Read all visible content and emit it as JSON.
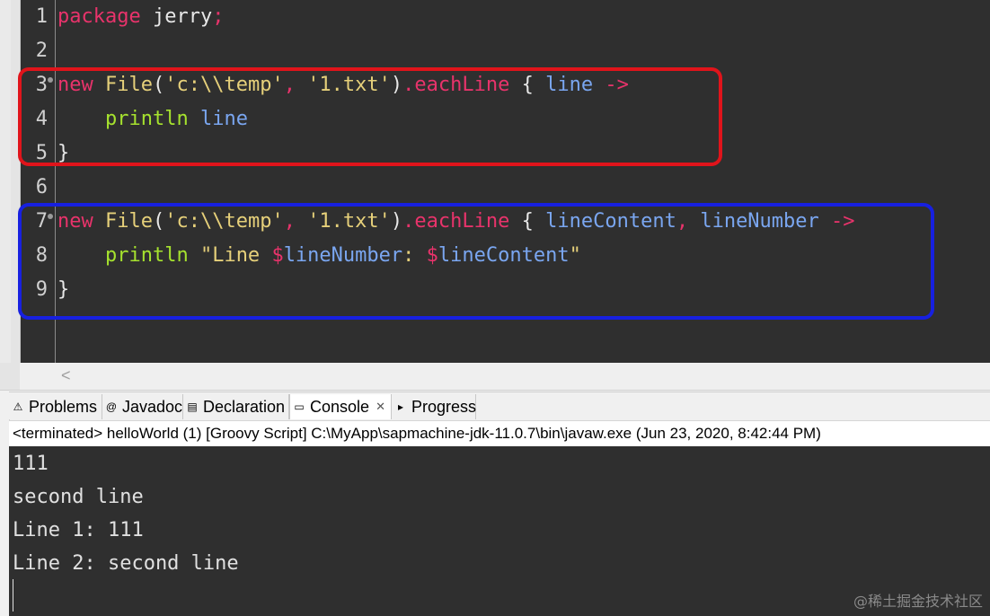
{
  "editor": {
    "lines": [
      {
        "num": "1",
        "tokens": [
          {
            "t": "package",
            "c": "kw"
          },
          {
            "t": " ",
            "c": "ident"
          },
          {
            "t": "jerry",
            "c": "ident"
          },
          {
            "t": ";",
            "c": "kw"
          }
        ]
      },
      {
        "num": "2",
        "tokens": []
      },
      {
        "num": "3",
        "fold": true,
        "tokens": [
          {
            "t": "new",
            "c": "kw"
          },
          {
            "t": " ",
            "c": "ident"
          },
          {
            "t": "File",
            "c": "cls"
          },
          {
            "t": "(",
            "c": "punct"
          },
          {
            "t": "'c:\\\\temp'",
            "c": "str"
          },
          {
            "t": ", ",
            "c": "kw"
          },
          {
            "t": "'1.txt'",
            "c": "str"
          },
          {
            "t": ")",
            "c": "punct"
          },
          {
            "t": ".eachLine",
            "c": "meth"
          },
          {
            "t": " { ",
            "c": "punct"
          },
          {
            "t": "line",
            "c": "var"
          },
          {
            "t": " ->",
            "c": "arrow"
          }
        ]
      },
      {
        "num": "4",
        "tokens": [
          {
            "t": "    ",
            "c": "ident"
          },
          {
            "t": "println",
            "c": "fn"
          },
          {
            "t": " ",
            "c": "ident"
          },
          {
            "t": "line",
            "c": "var"
          }
        ]
      },
      {
        "num": "5",
        "tokens": [
          {
            "t": "}",
            "c": "punct"
          }
        ]
      },
      {
        "num": "6",
        "tokens": []
      },
      {
        "num": "7",
        "fold": true,
        "tokens": [
          {
            "t": "new",
            "c": "kw"
          },
          {
            "t": " ",
            "c": "ident"
          },
          {
            "t": "File",
            "c": "cls"
          },
          {
            "t": "(",
            "c": "punct"
          },
          {
            "t": "'c:\\\\temp'",
            "c": "str"
          },
          {
            "t": ", ",
            "c": "kw"
          },
          {
            "t": "'1.txt'",
            "c": "str"
          },
          {
            "t": ")",
            "c": "punct"
          },
          {
            "t": ".eachLine",
            "c": "meth"
          },
          {
            "t": " { ",
            "c": "punct"
          },
          {
            "t": "lineContent",
            "c": "var"
          },
          {
            "t": ", ",
            "c": "kw"
          },
          {
            "t": "lineNumber",
            "c": "var"
          },
          {
            "t": " ->",
            "c": "arrow"
          }
        ]
      },
      {
        "num": "8",
        "tokens": [
          {
            "t": "    ",
            "c": "ident"
          },
          {
            "t": "println",
            "c": "fn"
          },
          {
            "t": " ",
            "c": "ident"
          },
          {
            "t": "\"Line ",
            "c": "gstr"
          },
          {
            "t": "$",
            "c": "kw"
          },
          {
            "t": "lineNumber",
            "c": "var"
          },
          {
            "t": ": ",
            "c": "gstr"
          },
          {
            "t": "$",
            "c": "kw"
          },
          {
            "t": "lineContent",
            "c": "var"
          },
          {
            "t": "\"",
            "c": "gstr"
          }
        ]
      },
      {
        "num": "9",
        "tokens": [
          {
            "t": "}",
            "c": "punct"
          }
        ]
      }
    ]
  },
  "tabs": [
    {
      "label": "Problems",
      "icon": "problems-icon",
      "glyph": "⚠"
    },
    {
      "label": "Javadoc",
      "icon": "javadoc-icon",
      "glyph": "@"
    },
    {
      "label": "Declaration",
      "icon": "declaration-icon",
      "glyph": "▤"
    },
    {
      "label": "Console",
      "icon": "console-icon",
      "glyph": "▭",
      "active": true,
      "close": "✕"
    },
    {
      "label": "Progress",
      "icon": "progress-icon",
      "glyph": "▸"
    }
  ],
  "console": {
    "status": "<terminated> helloWorld (1) [Groovy Script] C:\\MyApp\\sapmachine-jdk-11.0.7\\bin\\javaw.exe (Jun 23, 2020, 8:42:44 PM)",
    "output": [
      "111",
      "second line",
      "Line 1: 111",
      "Line 2: second line"
    ]
  },
  "scroll_left_glyph": "<",
  "watermark": "@稀土掘金技术社区"
}
